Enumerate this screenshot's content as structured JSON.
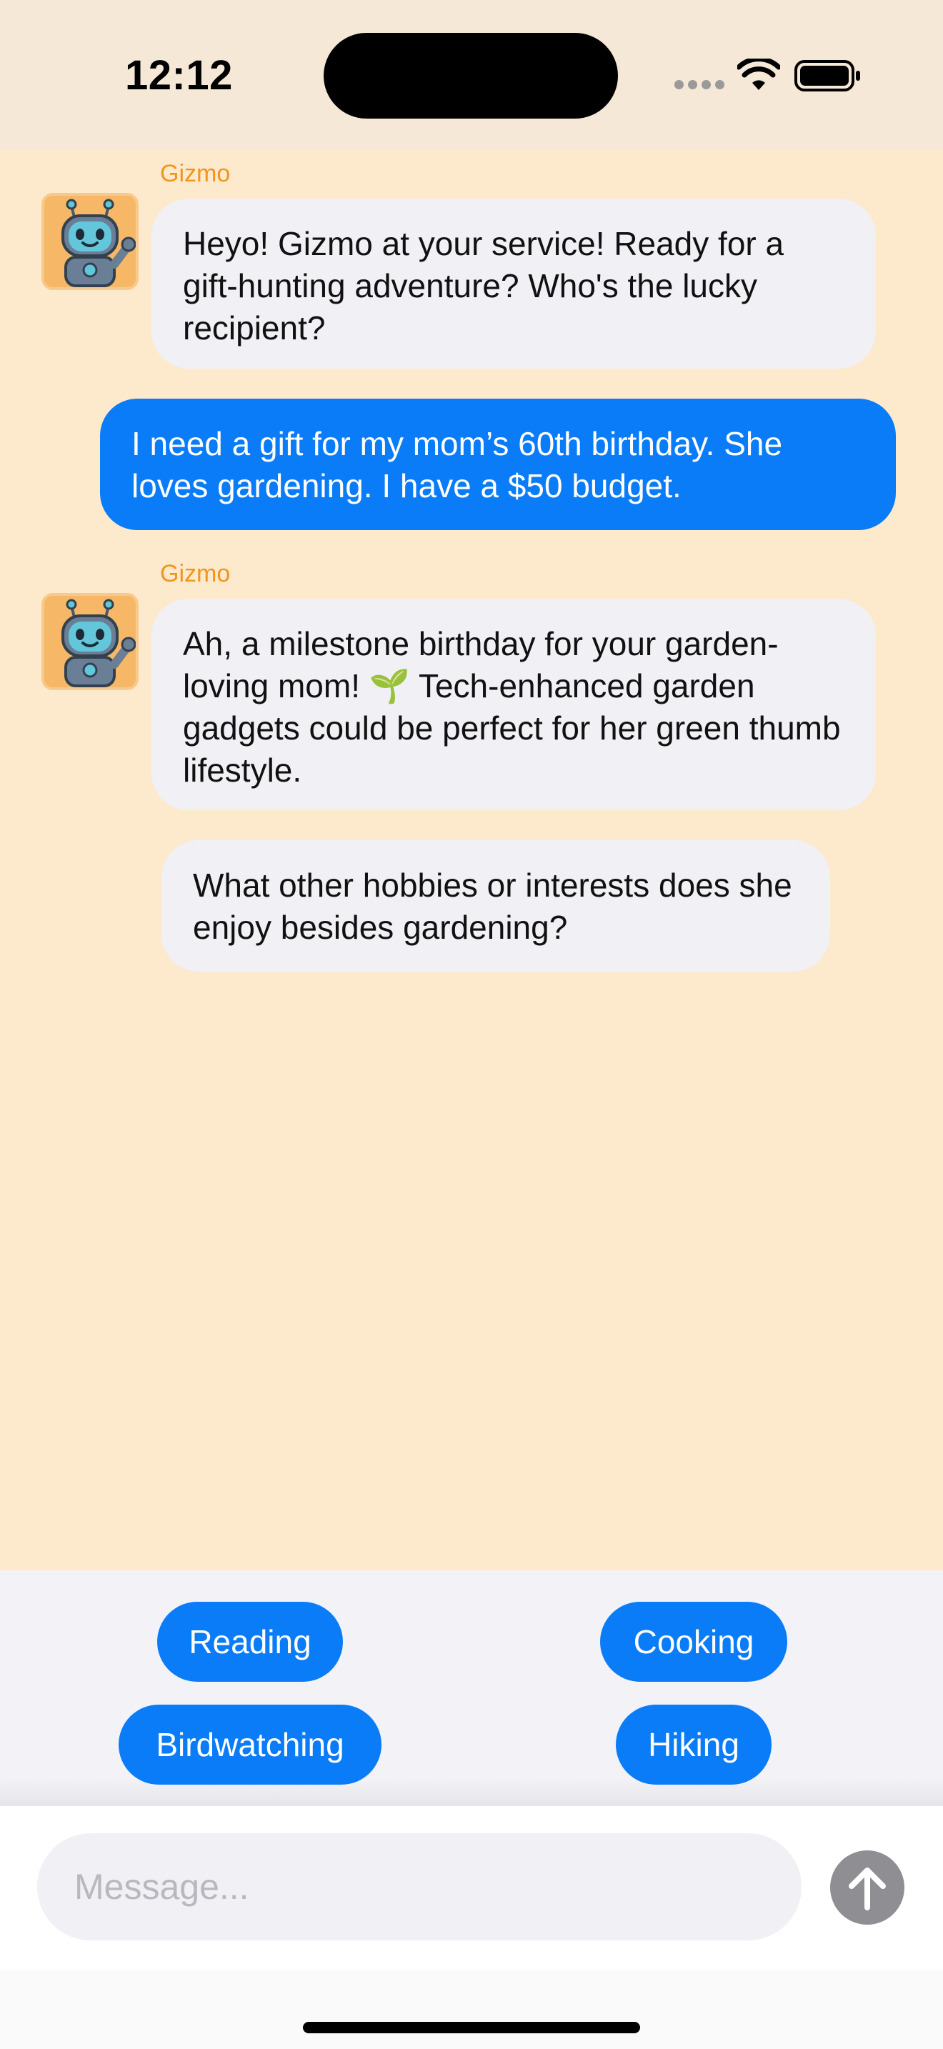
{
  "status_bar": {
    "time": "12:12",
    "icons": [
      "signal-dots-icon",
      "wifi-icon",
      "battery-icon"
    ]
  },
  "chat": {
    "messages": [
      {
        "role": "bot",
        "sender": "Gizmo",
        "avatar": "robot-avatar-icon",
        "text": "Heyo! Gizmo at your service! Ready for a gift-hunting adventure? Who's the lucky recipient?"
      },
      {
        "role": "user",
        "text": "I need a gift for my mom’s 60th birthday. She loves gardening. I have a $50 budget."
      },
      {
        "role": "bot",
        "sender": "Gizmo",
        "avatar": "robot-avatar-icon",
        "text": "Ah, a milestone birthday for your garden-loving mom! 🌱 Tech-enhanced garden gadgets could be perfect for her green thumb lifestyle."
      },
      {
        "role": "bot",
        "text": "What other hobbies or interests does she enjoy besides gardening?"
      }
    ]
  },
  "quick_replies": [
    "Reading",
    "Cooking",
    "Birdwatching",
    "Hiking"
  ],
  "composer": {
    "placeholder": "Message...",
    "value": "",
    "send_icon": "arrow-up-icon"
  },
  "colors": {
    "chat_background": "#fde9cc",
    "status_bar_background": "#f5e8d6",
    "accent_blue": "#0a7cf8",
    "bot_bubble": "#f0f0f5",
    "sender_name": "#f0951f",
    "send_button": "#8e8e93"
  }
}
